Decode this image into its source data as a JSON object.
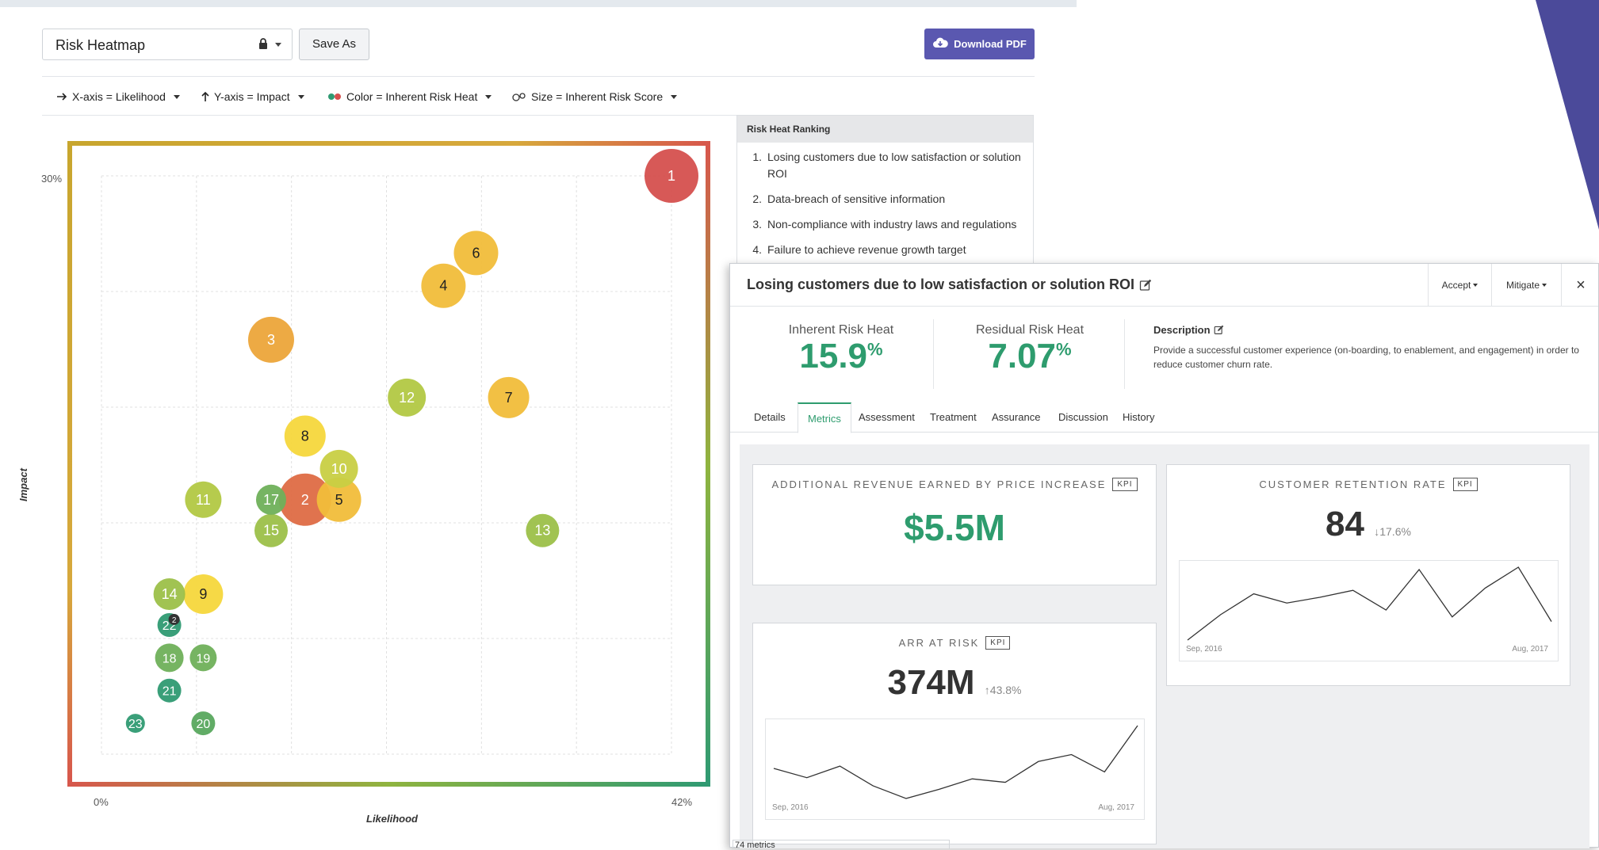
{
  "toolbar": {
    "view_name": "Risk Heatmap",
    "save_as_label": "Save As",
    "download_label": "Download PDF"
  },
  "filters": [
    {
      "label": "X-axis = Likelihood",
      "icon": "arrow-right-icon"
    },
    {
      "label": "Y-axis = Impact",
      "icon": "arrow-up-icon"
    },
    {
      "label": "Color = Inherent Risk Heat",
      "icon": "color-dots-icon"
    },
    {
      "label": "Size = Inherent Risk Score",
      "icon": "size-circles-icon"
    }
  ],
  "chart_data": {
    "type": "scatter",
    "xlabel": "Likelihood",
    "ylabel": "Impact",
    "x_tick_labels": [
      "0%",
      "42%"
    ],
    "y_tick_labels": [
      "30%"
    ],
    "xlim": [
      0,
      42
    ],
    "ylim": [
      0,
      30
    ],
    "grid": true,
    "points": [
      {
        "label": "1",
        "x": 42,
        "y": 30,
        "size": 34,
        "color": "#d5504e"
      },
      {
        "label": "2",
        "x": 15,
        "y": 13.2,
        "size": 33,
        "color": "#de6b45"
      },
      {
        "label": "3",
        "x": 12.5,
        "y": 21.5,
        "size": 29,
        "color": "#eca53a"
      },
      {
        "label": "4",
        "x": 25.2,
        "y": 24.3,
        "size": 28,
        "color": "#f1bd3a"
      },
      {
        "label": "5",
        "x": 17.5,
        "y": 13.2,
        "size": 28,
        "color": "#f1bd3a"
      },
      {
        "label": "6",
        "x": 27.6,
        "y": 26,
        "size": 28,
        "color": "#f1bd3a"
      },
      {
        "label": "7",
        "x": 30,
        "y": 18.5,
        "size": 26,
        "color": "#f1bd3a"
      },
      {
        "label": "8",
        "x": 15,
        "y": 16.5,
        "size": 26,
        "color": "#f6d73c"
      },
      {
        "label": "9",
        "x": 7.5,
        "y": 8.3,
        "size": 25,
        "color": "#f6d73c"
      },
      {
        "label": "10",
        "x": 17.5,
        "y": 14.8,
        "size": 24,
        "color": "#c8cf43"
      },
      {
        "label": "11",
        "x": 7.5,
        "y": 13.2,
        "size": 23,
        "color": "#b2c843"
      },
      {
        "label": "12",
        "x": 22.5,
        "y": 18.5,
        "size": 24,
        "color": "#b2c843"
      },
      {
        "label": "13",
        "x": 32.5,
        "y": 11.6,
        "size": 21,
        "color": "#9cc049"
      },
      {
        "label": "14",
        "x": 5,
        "y": 8.3,
        "size": 20,
        "color": "#9cc049"
      },
      {
        "label": "15",
        "x": 12.5,
        "y": 11.6,
        "size": 21,
        "color": "#9cc049"
      },
      {
        "label": "17",
        "x": 12.5,
        "y": 13.2,
        "size": 19,
        "color": "#6fb05a"
      },
      {
        "label": "18",
        "x": 5,
        "y": 5,
        "size": 18,
        "color": "#6fb05a"
      },
      {
        "label": "19",
        "x": 7.5,
        "y": 5,
        "size": 17,
        "color": "#6fb05a"
      },
      {
        "label": "20",
        "x": 7.5,
        "y": 1.6,
        "size": 15,
        "color": "#58a85e"
      },
      {
        "label": "21",
        "x": 5,
        "y": 3.3,
        "size": 15,
        "color": "#2f9a72"
      },
      {
        "label": "22",
        "x": 5,
        "y": 6.7,
        "size": 15,
        "color": "#2f9a72"
      },
      {
        "label": "23",
        "x": 2.5,
        "y": 1.6,
        "size": 12,
        "color": "#2f9a72"
      }
    ],
    "cluster_badge": "2"
  },
  "ranking": {
    "title": "Risk Heat Ranking",
    "items": [
      {
        "n": "1.",
        "text": "Losing customers due to low satisfaction or solution ROI"
      },
      {
        "n": "2.",
        "text": "Data-breach of sensitive information"
      },
      {
        "n": "3.",
        "text": "Non-compliance with industry laws and regulations"
      },
      {
        "n": "4.",
        "text": "Failure to achieve revenue growth target"
      }
    ]
  },
  "panel": {
    "title": "Losing customers due to low satisfaction or solution ROI",
    "accept_label": "Accept",
    "mitigate_label": "Mitigate",
    "close_symbol": "×",
    "inherent_label": "Inherent Risk Heat",
    "inherent_value": "15.9",
    "residual_label": "Residual Risk Heat",
    "residual_value": "7.07",
    "percent_sign": "%",
    "description_title": "Description",
    "description_text": "Provide a successful customer experience (on-boarding, to enablement, and engagement) in order to reduce customer churn rate.",
    "tabs": [
      "Details",
      "Metrics",
      "Assessment",
      "Treatment",
      "Assurance",
      "Discussion",
      "History"
    ],
    "active_tab": "Metrics",
    "kpi_badge": "KPI",
    "metrics": {
      "revenue": {
        "title": "ADDITIONAL REVENUE EARNED BY PRICE INCREASE",
        "value": "$5.5M"
      },
      "retention": {
        "title": "CUSTOMER RETENTION RATE",
        "value": "84",
        "change": "↓17.6%",
        "start": "Sep, 2016",
        "end": "Aug, 2017",
        "series": [
          2,
          24,
          42,
          34,
          39,
          45,
          28,
          63,
          22,
          47,
          65,
          18
        ]
      },
      "arr": {
        "title": "ARR AT RISK",
        "value": "374M",
        "change": "↑43.8%",
        "start": "Sep, 2016",
        "end": "Aug, 2017",
        "series": [
          55,
          47,
          57,
          40,
          29,
          37,
          46,
          43,
          61,
          67,
          52,
          92
        ]
      }
    },
    "footer": "74 metrics"
  },
  "colors": {
    "accent_green": "#2e9c6e",
    "button_purple": "#5a58b0",
    "deco_navy": "#4b4a9a"
  }
}
